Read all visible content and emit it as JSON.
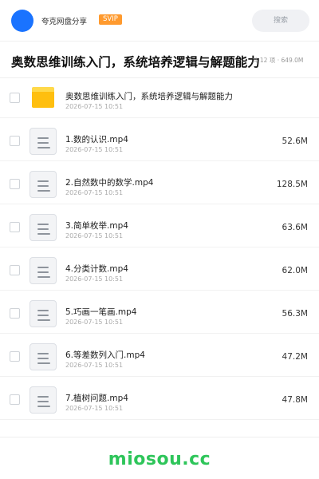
{
  "header": {
    "share_name": "夸克网盘分享",
    "badge": "SVIP",
    "search_label": "搜索",
    "avatar_color": "#1a73ff",
    "badge_color": "#ff9a2e"
  },
  "title": {
    "text": "奥数思维训练入门，系统培养逻辑与解题能力",
    "meta": "共 12 项 · 649.0M"
  },
  "items": [
    {
      "name": "奥数思维训练入门，系统培养逻辑与解题能力",
      "date": "2026-07-15 10:51",
      "size": "",
      "icon": "folder-icon"
    },
    {
      "name": "1.数的认识.mp4",
      "date": "2026-07-15 10:51",
      "size": "52.6M",
      "icon": "video-file-icon"
    },
    {
      "name": "2.自然数中的数学.mp4",
      "date": "2026-07-15 10:51",
      "size": "128.5M",
      "icon": "video-file-icon"
    },
    {
      "name": "3.简单枚举.mp4",
      "date": "2026-07-15 10:51",
      "size": "63.6M",
      "icon": "video-file-icon"
    },
    {
      "name": "4.分类计数.mp4",
      "date": "2026-07-15 10:51",
      "size": "62.0M",
      "icon": "video-file-icon"
    },
    {
      "name": "5.巧画一笔画.mp4",
      "date": "2026-07-15 10:51",
      "size": "56.3M",
      "icon": "video-file-icon"
    },
    {
      "name": "6.等差数列入门.mp4",
      "date": "2026-07-15 10:51",
      "size": "47.2M",
      "icon": "video-file-icon"
    },
    {
      "name": "7.植树问题.mp4",
      "date": "2026-07-15 10:51",
      "size": "47.8M",
      "icon": "video-file-icon"
    }
  ],
  "watermark": {
    "text": "miosou.cc",
    "color": "#2ec55a"
  }
}
